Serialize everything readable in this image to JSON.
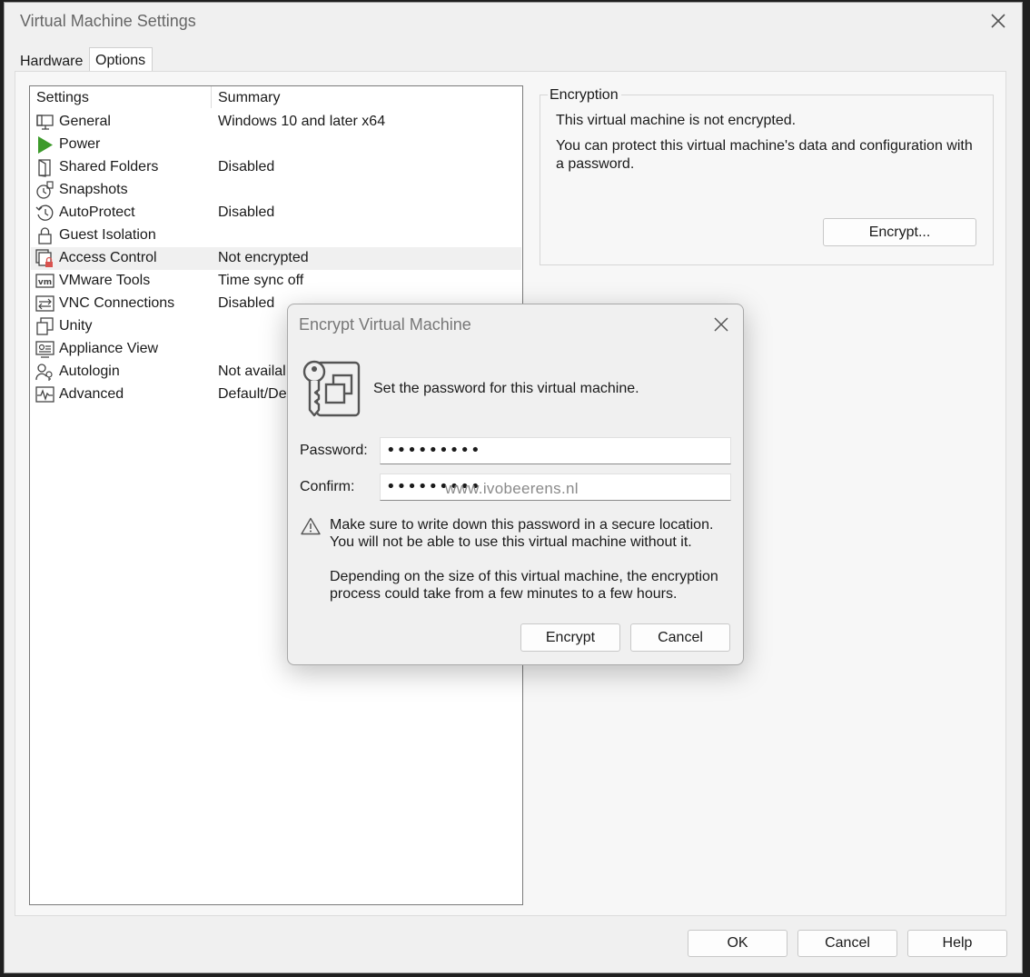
{
  "window": {
    "title": "Virtual Machine Settings"
  },
  "tabs": [
    {
      "label": "Hardware",
      "active": false
    },
    {
      "label": "Options",
      "active": true
    }
  ],
  "settings_list": {
    "columns": [
      "Settings",
      "Summary"
    ],
    "rows": [
      {
        "icon": "general-icon",
        "name": "General",
        "summary": "Windows 10 and later x64"
      },
      {
        "icon": "power-icon",
        "name": "Power",
        "summary": ""
      },
      {
        "icon": "shared-folders-icon",
        "name": "Shared Folders",
        "summary": "Disabled"
      },
      {
        "icon": "snapshots-icon",
        "name": "Snapshots",
        "summary": ""
      },
      {
        "icon": "autoprotect-icon",
        "name": "AutoProtect",
        "summary": "Disabled"
      },
      {
        "icon": "lock-icon",
        "name": "Guest Isolation",
        "summary": ""
      },
      {
        "icon": "access-control-icon",
        "name": "Access Control",
        "summary": "Not encrypted",
        "selected": true
      },
      {
        "icon": "vmware-tools-icon",
        "name": "VMware Tools",
        "summary": "Time sync off"
      },
      {
        "icon": "vnc-icon",
        "name": "VNC Connections",
        "summary": "Disabled"
      },
      {
        "icon": "unity-icon",
        "name": "Unity",
        "summary": ""
      },
      {
        "icon": "appliance-view-icon",
        "name": "Appliance View",
        "summary": ""
      },
      {
        "icon": "autologin-icon",
        "name": "Autologin",
        "summary": "Not availal"
      },
      {
        "icon": "advanced-icon",
        "name": "Advanced",
        "summary": "Default/De"
      }
    ]
  },
  "encryption": {
    "legend": "Encryption",
    "status": "This virtual machine is not encrypted.",
    "description": "You can protect this virtual machine's data and configuration with a password.",
    "encrypt_button": "Encrypt..."
  },
  "footer": {
    "ok": "OK",
    "cancel": "Cancel",
    "help": "Help"
  },
  "dialog": {
    "title": "Encrypt Virtual Machine",
    "prompt": "Set the password for this virtual machine.",
    "password_label": "Password:",
    "password_value": "•••••••••",
    "confirm_label": "Confirm:",
    "confirm_value": "•••••••••",
    "warning_1": "Make sure to write down this password in a secure location. You will not be able to use this virtual machine without it.",
    "warning_2": "Depending on the size of this virtual machine, the encryption process could take from a few minutes to a few hours.",
    "encrypt_button": "Encrypt",
    "cancel_button": "Cancel"
  },
  "watermark": "www.ivobeerens.nl",
  "colors": {
    "power_green": "#3c9a2a",
    "lock_red": "#d9534f",
    "selected_row": "#f0f0f0"
  }
}
